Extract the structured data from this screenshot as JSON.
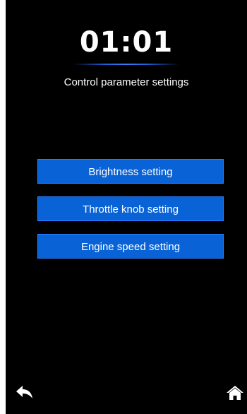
{
  "header": {
    "time": "01:01",
    "title": "Control parameter settings"
  },
  "menu": {
    "items": [
      {
        "label": "Brightness setting"
      },
      {
        "label": "Throttle knob setting"
      },
      {
        "label": "Engine speed setting"
      }
    ]
  },
  "footer": {
    "back_icon": "back-arrow-icon",
    "home_icon": "home-icon"
  },
  "colors": {
    "background": "#000000",
    "button": "#0a63d6",
    "text": "#ffffff"
  }
}
